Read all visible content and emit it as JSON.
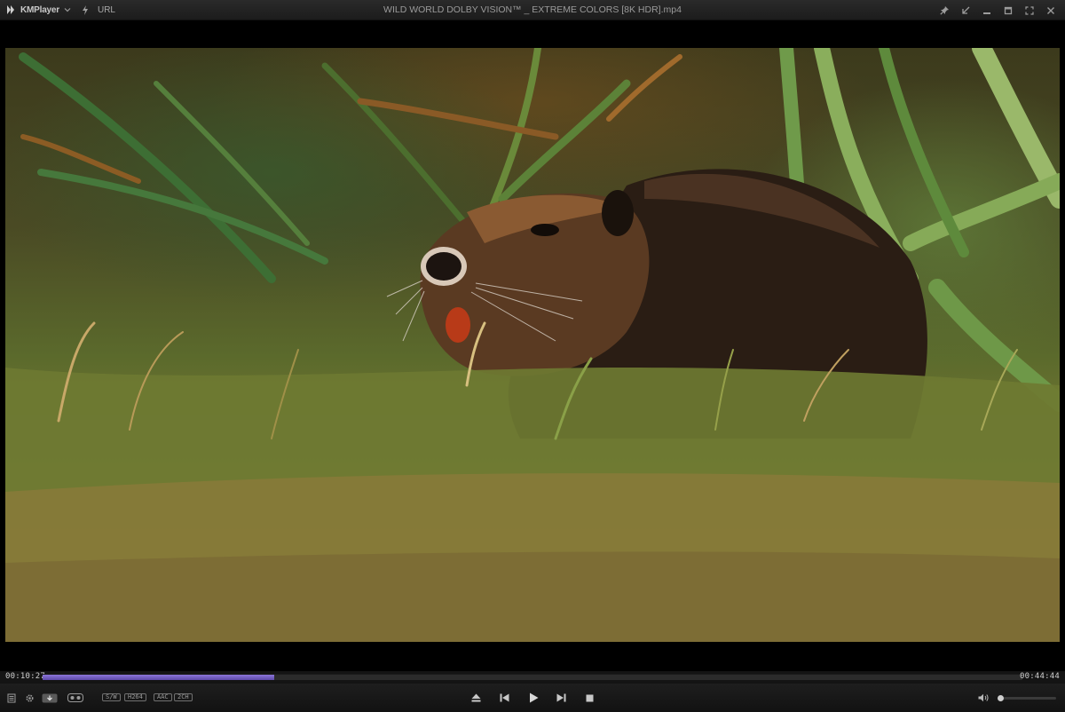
{
  "app": {
    "name": "KMPlayer",
    "url_label": "URL"
  },
  "window": {
    "title": "WILD WORLD DOLBY VISION™ _ EXTREME COLORS [8K HDR].mp4"
  },
  "playback": {
    "current_time": "00:10:27",
    "total_time": "00:44:44",
    "progress": 0.236,
    "volume": 0.0
  },
  "badges": [
    "S/W",
    "H264",
    "AAC",
    "2CH"
  ],
  "icons": {
    "titlebar_left": [
      "kmplayer-logo-icon",
      "chevron-down-icon",
      "flash-icon"
    ],
    "window_controls": [
      "pin-icon",
      "shrink-icon",
      "minimize-icon",
      "maximize-icon",
      "fullscreen-icon",
      "close-icon"
    ],
    "bottom_left": [
      "playlist-icon",
      "settings-icon",
      "capture-icon",
      "vr-icon"
    ],
    "transport": [
      "eject-icon",
      "previous-icon",
      "play-icon",
      "next-icon",
      "stop-icon"
    ],
    "bottom_right": [
      "volume-icon"
    ]
  },
  "colors": {
    "seek_fill": "#7a64c8",
    "background": "#000000",
    "bar": "#1a1a1a"
  }
}
